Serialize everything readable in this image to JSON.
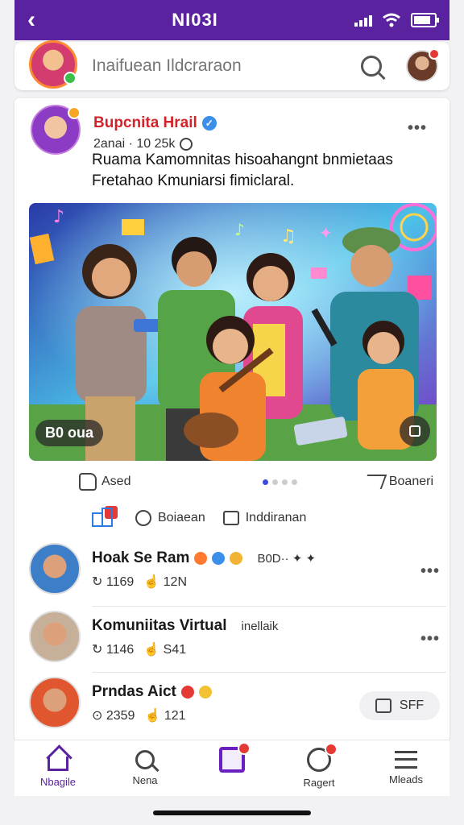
{
  "topbar": {
    "back": "‹",
    "title": "NI03I",
    "battery_level": 0.85
  },
  "search": {
    "placeholder": "Inaifuean Ildcraraon"
  },
  "post": {
    "author": "Bupcnita Hrail",
    "meta": "2anai · 10 25k",
    "text": "Ruama Kamomnitas hisoahangnt bnmietaas Fretahao Kmuniarsi fimiclaral.",
    "media_tag": "B0 oua",
    "like_label": "Ased",
    "share_label": "Boaneri",
    "carousel_index": 1,
    "carousel_count": 4,
    "comment_label": "Boiaean",
    "save_label": "Inddiranan"
  },
  "list": [
    {
      "name": "Hoak Se Ram",
      "extra": "B0D·· ✦ ✦",
      "stat1": "1169",
      "stat2": "12N"
    },
    {
      "name": "Komuniitas Virtual",
      "extra": "inellaik",
      "stat1": "1146",
      "stat2": "S41"
    },
    {
      "name": "Prndas Aict",
      "extra": "",
      "stat1": "2359",
      "stat2": "121",
      "reply": "SFF"
    }
  ],
  "nav": [
    {
      "label": "Nbagile",
      "icon": "home-icon"
    },
    {
      "label": "Nena",
      "icon": "search-icon"
    },
    {
      "label": "",
      "icon": "create-icon"
    },
    {
      "label": "Ragert",
      "icon": "reaction-icon"
    },
    {
      "label": "Mleads",
      "icon": "menu-icon"
    }
  ],
  "colors": {
    "brand": "#5b22a0",
    "accent": "#d2232a",
    "verified": "#3b8fe8"
  }
}
